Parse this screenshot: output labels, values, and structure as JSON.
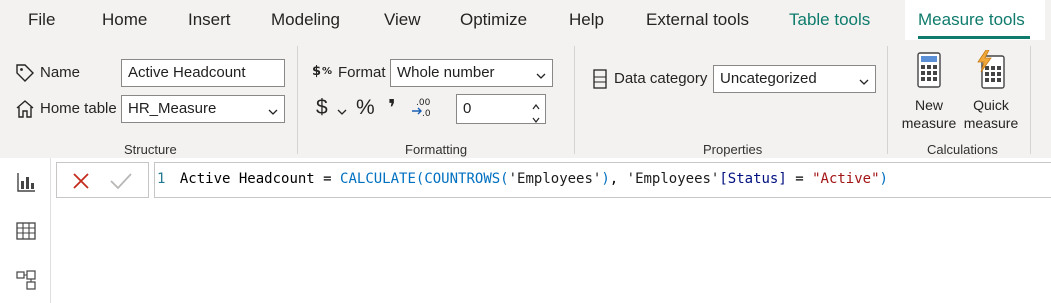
{
  "tabs": [
    {
      "label": "File"
    },
    {
      "label": "Home"
    },
    {
      "label": "Insert"
    },
    {
      "label": "Modeling"
    },
    {
      "label": "View"
    },
    {
      "label": "Optimize"
    },
    {
      "label": "Help"
    },
    {
      "label": "External tools"
    },
    {
      "label": "Table tools"
    },
    {
      "label": "Measure tools"
    }
  ],
  "active_tab": "Measure tools",
  "accent_color": "#0f7b6c",
  "structure": {
    "group_label": "Structure",
    "name_label": "Name",
    "name_value": "Active Headcount",
    "home_table_label": "Home table",
    "home_table_value": "HR_Measure"
  },
  "formatting": {
    "group_label": "Formatting",
    "format_label": "Format",
    "format_value": "Whole number",
    "currency_symbol": "$",
    "percent_symbol": "%",
    "comma_symbol": "❜",
    "decimal_places": "0"
  },
  "properties": {
    "group_label": "Properties",
    "data_category_label": "Data category",
    "data_category_value": "Uncategorized"
  },
  "calculations": {
    "group_label": "Calculations",
    "new_measure_line1": "New",
    "new_measure_line2": "measure",
    "quick_measure_line1": "Quick",
    "quick_measure_line2": "measure"
  },
  "formula": {
    "line_number": "1",
    "tokens": [
      {
        "text": "Active Headcount = ",
        "kind": "plain"
      },
      {
        "text": "CALCULATE(",
        "kind": "fn"
      },
      {
        "text": "COUNTROWS(",
        "kind": "fn"
      },
      {
        "text": "'Employees'",
        "kind": "tbl"
      },
      {
        "text": ")",
        "kind": "fn"
      },
      {
        "text": ", ",
        "kind": "plain"
      },
      {
        "text": "'Employees'",
        "kind": "tbl"
      },
      {
        "text": "[Status]",
        "kind": "col"
      },
      {
        "text": " = ",
        "kind": "plain"
      },
      {
        "text": "\"Active\"",
        "kind": "str"
      },
      {
        "text": ")",
        "kind": "fn"
      }
    ]
  }
}
